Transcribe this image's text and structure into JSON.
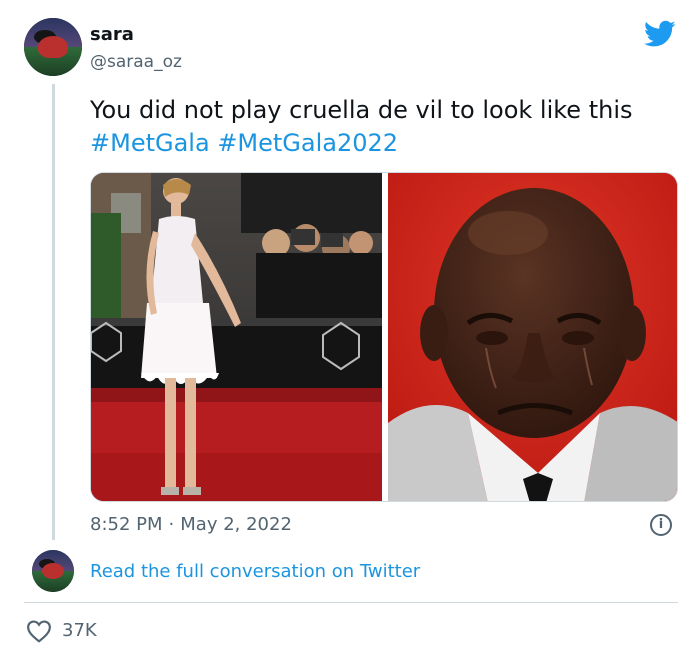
{
  "tweet": {
    "author_name": "sara",
    "author_handle": "@saraa_oz",
    "text_plain": "You did not play cruella de vil to look like this",
    "hashtags": [
      "#MetGala",
      "#MetGala2022"
    ],
    "time": "8:52 PM",
    "separator": "·",
    "date": "May 2, 2022",
    "info_symbol": "i",
    "read_conversation": "Read the full conversation on Twitter",
    "likes": "37K"
  },
  "icons": {
    "brand": "twitter-bird-icon",
    "info": "info-icon",
    "like": "heart-icon"
  },
  "colors": {
    "link_blue": "#1b95e0",
    "twitter_blue": "#1d9bf0",
    "muted_text": "#536471",
    "border": "#cfd9de"
  }
}
